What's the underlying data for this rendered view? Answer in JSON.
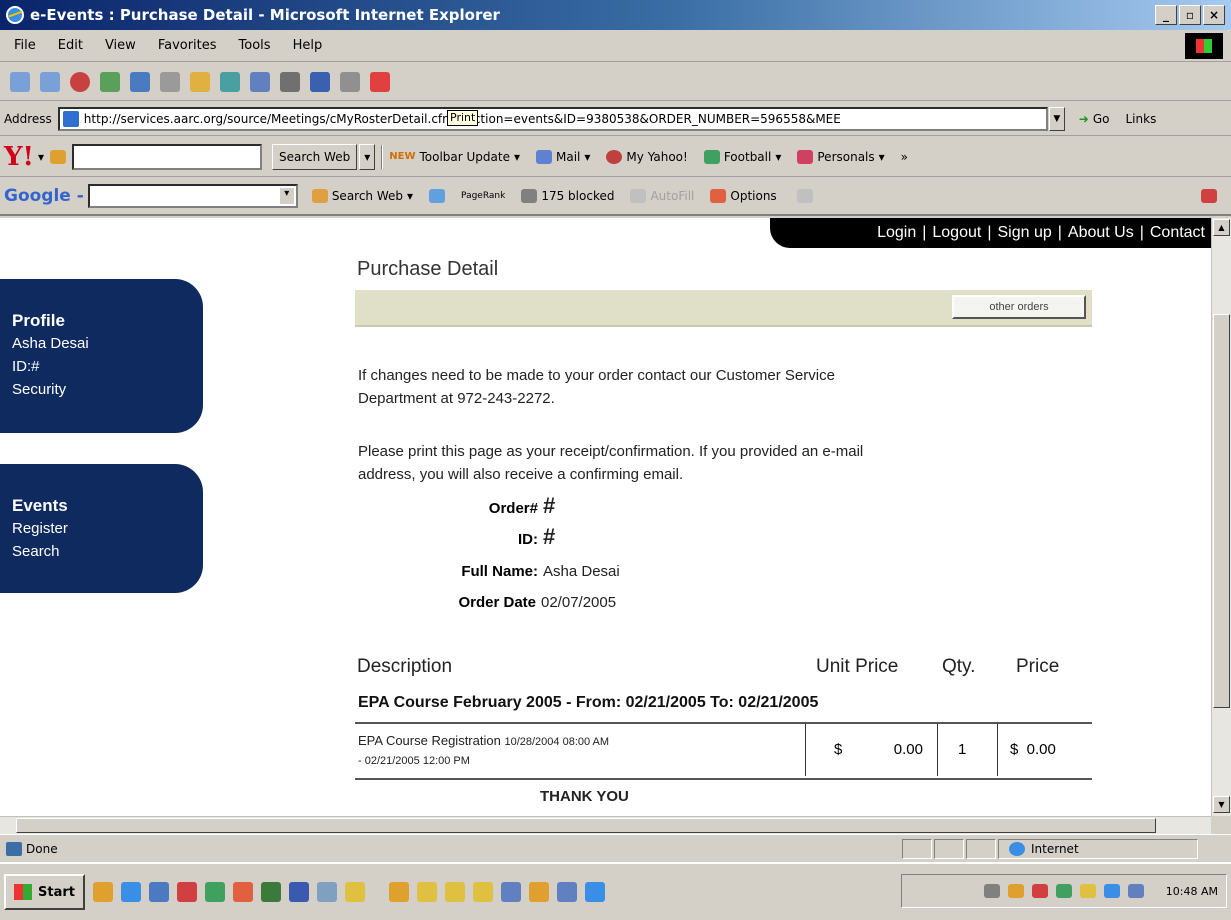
{
  "window": {
    "title": "e-Events : Purchase Detail - Microsoft Internet Explorer",
    "buttons": {
      "minimize": "_",
      "maximize": "▫",
      "close": "×"
    }
  },
  "menu": [
    "File",
    "Edit",
    "View",
    "Favorites",
    "Tools",
    "Help"
  ],
  "address": {
    "label": "Address",
    "url": "http://services.aarc.org/source/Meetings/cMyRosterDetail.cfm?section=events&ID=9380538&ORDER_NUMBER=596558&MEE",
    "tooltip": "Print",
    "go": "Go",
    "links": "Links"
  },
  "yahoo": {
    "search_web": "Search Web",
    "new": "NEW",
    "update": "Toolbar Update",
    "mail": "Mail",
    "my_yahoo": "My Yahoo!",
    "football": "Football",
    "personals": "Personals",
    "more": "»"
  },
  "google": {
    "logo": "Google -",
    "search_web": "Search Web",
    "pagerank": "PageRank",
    "blocked": "175 blocked",
    "autofill": "AutoFill",
    "options": "Options"
  },
  "topnav": [
    "Login",
    "Logout",
    "Sign up",
    "About Us",
    "Contact"
  ],
  "sidebar": {
    "profile": {
      "heading": "Profile",
      "name": "Asha Desai",
      "id": "ID:#",
      "security": "Security"
    },
    "events": {
      "heading": "Events",
      "register": "Register",
      "search": "Search"
    }
  },
  "page": {
    "title": "Purchase Detail",
    "other_orders": "other orders",
    "para1_line1": "If changes need to be made to your order contact our Customer Service",
    "para1_line2": "Department at 972-243-2272.",
    "para2_line1": "Please print this page as your receipt/confirmation. If you provided an e-mail",
    "para2_line2": "address, you will also receive a confirming email.",
    "order_label": "Order#",
    "order_value": "#",
    "id_label": "ID:",
    "id_value": "#",
    "fullname_label": "Full Name:",
    "fullname_value": "Asha Desai",
    "orderdate_label": "Order Date",
    "orderdate_value": "02/07/2005",
    "table": {
      "headers": {
        "description": "Description",
        "unit_price": "Unit Price",
        "qty": "Qty.",
        "price": "Price"
      },
      "course": "EPA Course February 2005 - From: 02/21/2005 To: 02/21/2005",
      "row": {
        "name": "EPA Course Registration",
        "start": "10/28/2004 08:00 AM",
        "end": "- 02/21/2005 12:00 PM",
        "currency": "$",
        "unit_price": "0.00",
        "qty": "1",
        "price": "$  0.00"
      }
    },
    "thank_you": "THANK YOU"
  },
  "status": {
    "text": "Done",
    "zone": "Internet"
  },
  "taskbar": {
    "start": "Start",
    "clock": "10:48 AM"
  }
}
